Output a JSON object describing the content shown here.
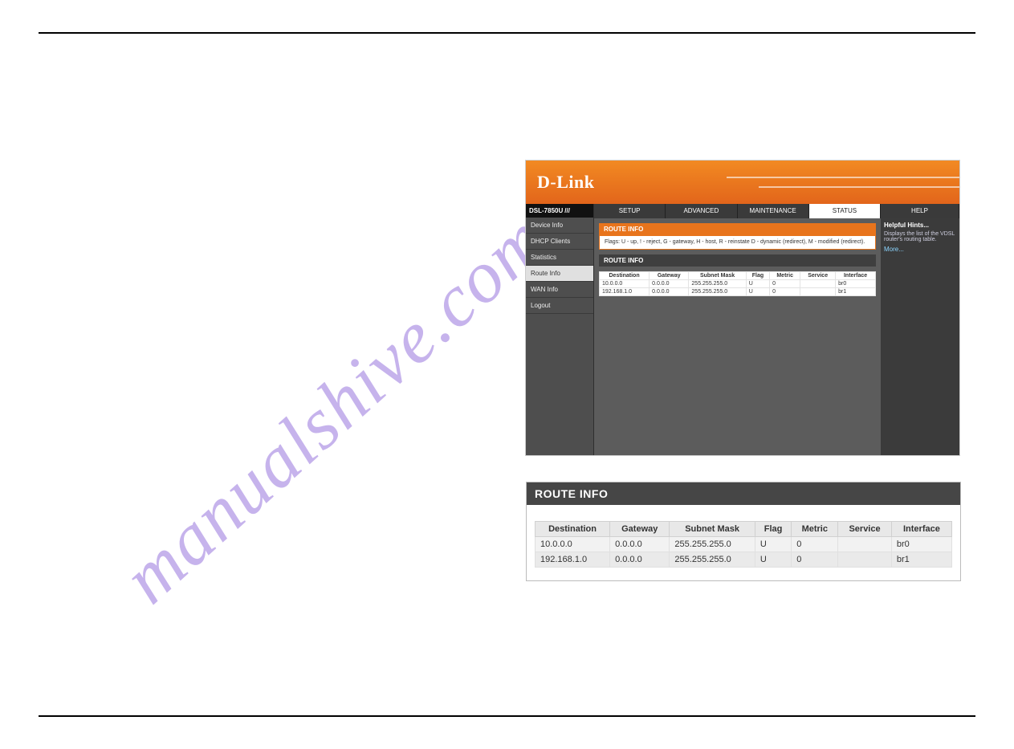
{
  "watermark": "manualshive.com",
  "router": {
    "brand": "D-Link",
    "model": "DSL-7850U",
    "sidebar": {
      "items": [
        {
          "label": "Device Info"
        },
        {
          "label": "DHCP Clients"
        },
        {
          "label": "Statistics"
        },
        {
          "label": "Route Info",
          "active": true
        },
        {
          "label": "WAN Info"
        },
        {
          "label": "Logout"
        }
      ]
    },
    "tabs": [
      {
        "label": "SETUP"
      },
      {
        "label": "ADVANCED"
      },
      {
        "label": "MAINTENANCE"
      },
      {
        "label": "STATUS",
        "active": true
      },
      {
        "label": "HELP"
      }
    ],
    "panel": {
      "title": "ROUTE INFO",
      "flags": "Flags: U - up, ! - reject, G - gateway, H - host, R - reinstate\nD - dynamic (redirect), M - modified (redirect).",
      "subtitle": "ROUTE INFO",
      "columns": [
        "Destination",
        "Gateway",
        "Subnet Mask",
        "Flag",
        "Metric",
        "Service",
        "Interface"
      ],
      "rows": [
        {
          "destination": "10.0.0.0",
          "gateway": "0.0.0.0",
          "mask": "255.255.255.0",
          "flag": "U",
          "metric": "0",
          "service": "",
          "iface": "br0"
        },
        {
          "destination": "192.168.1.0",
          "gateway": "0.0.0.0",
          "mask": "255.255.255.0",
          "flag": "U",
          "metric": "0",
          "service": "",
          "iface": "br1"
        }
      ]
    },
    "help": {
      "title": "Helpful Hints...",
      "body": "Displays the list of the VDSL router's routing table.",
      "more": "More..."
    }
  },
  "detail": {
    "title": "ROUTE INFO",
    "columns": [
      "Destination",
      "Gateway",
      "Subnet Mask",
      "Flag",
      "Metric",
      "Service",
      "Interface"
    ],
    "rows": [
      {
        "destination": "10.0.0.0",
        "gateway": "0.0.0.0",
        "mask": "255.255.255.0",
        "flag": "U",
        "metric": "0",
        "service": "",
        "iface": "br0"
      },
      {
        "destination": "192.168.1.0",
        "gateway": "0.0.0.0",
        "mask": "255.255.255.0",
        "flag": "U",
        "metric": "0",
        "service": "",
        "iface": "br1"
      }
    ]
  }
}
